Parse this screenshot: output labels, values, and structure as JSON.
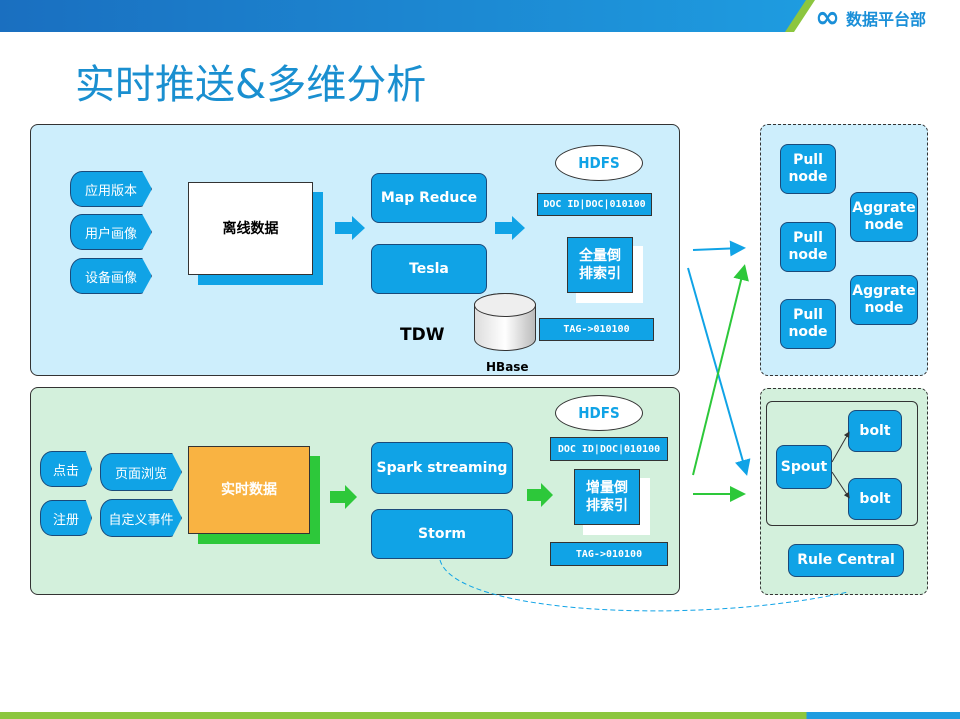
{
  "header": {
    "logo_text": "数据平台部",
    "logo_icon": "infinity-icon"
  },
  "title": "实时推送&多维分析",
  "offline": {
    "sources": [
      "应用版本",
      "用户画像",
      "设备画像"
    ],
    "data_label": "离线数据",
    "compute": [
      "Map Reduce",
      "Tesla"
    ],
    "hdfs": "HDFS",
    "doc_row": "DOC ID|DOC|010100",
    "index_label": "全量倒排索引",
    "tag_row": "TAG->010100",
    "hbase": "HBase",
    "tdw": "TDW"
  },
  "realtime": {
    "sources": [
      "点击",
      "注册",
      "页面浏览",
      "自定义事件"
    ],
    "data_label": "实时数据",
    "compute": [
      "Spark streaming",
      "Storm"
    ],
    "hdfs": "HDFS",
    "doc_row": "DOC ID|DOC|010100",
    "index_label": "增量倒排索引",
    "tag_row": "TAG->010100"
  },
  "query": {
    "pull_nodes": [
      "Pull node",
      "Pull node",
      "Pull node"
    ],
    "aggr_nodes": [
      "Aggrate node",
      "Aggrate node"
    ]
  },
  "storm_topology": {
    "spout": "Spout",
    "bolts": [
      "bolt",
      "bolt"
    ],
    "rule_central": "Rule Central"
  },
  "colors": {
    "blue": "#10a3e6",
    "offline_bg": "#cdeefc",
    "realtime_bg": "#d3f0dc",
    "orange": "#f9b342",
    "green": "#2dc83a"
  }
}
